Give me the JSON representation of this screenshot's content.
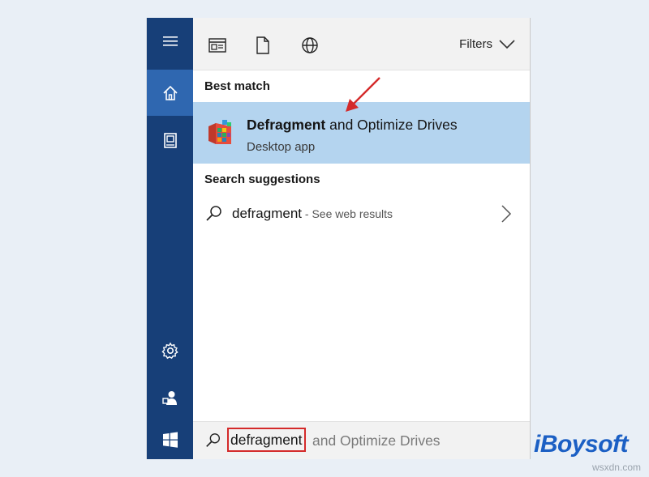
{
  "rail": {
    "items": [
      {
        "name": "hamburger-menu-icon",
        "active": false
      },
      {
        "name": "home-icon",
        "active": true
      },
      {
        "name": "documents-icon",
        "active": false
      },
      {
        "name": "settings-icon",
        "active": false
      },
      {
        "name": "user-feedback-icon",
        "active": false
      },
      {
        "name": "windows-start-icon",
        "active": false
      }
    ]
  },
  "topbar": {
    "icons": [
      "apps-filter-icon",
      "documents-filter-icon",
      "web-filter-icon"
    ],
    "filters_label": "Filters"
  },
  "best_match": {
    "heading": "Best match",
    "title_bold": "Defragment",
    "title_rest": " and Optimize Drives",
    "subtitle": "Desktop app"
  },
  "suggestions": {
    "heading": "Search suggestions",
    "items": [
      {
        "term": "defragment",
        "extra": " - See web results"
      }
    ]
  },
  "searchbar": {
    "typed": "defragment",
    "completion": "and Optimize Drives"
  },
  "watermark": {
    "brand_prefix": "i",
    "brand": "Boysoft",
    "site": "wsxdn.com"
  },
  "colors": {
    "rail": "#173f78",
    "rail_active": "#2f67b0",
    "highlight": "#b4d4ef",
    "annotation": "#d42a2a"
  }
}
